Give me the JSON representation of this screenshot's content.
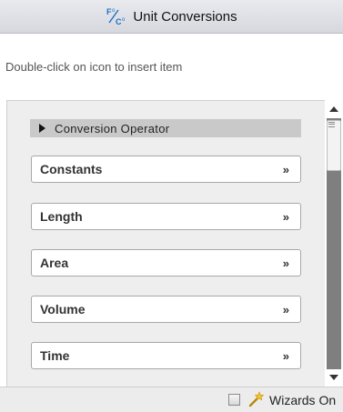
{
  "window": {
    "title": "Unit Conversions",
    "title_icon": "unit-conversions-icon"
  },
  "hint": "Double-click on icon to insert item",
  "conversion_operator": {
    "label": "Conversion Operator",
    "icon": "triangle-right-icon"
  },
  "categories": [
    {
      "label": "Constants",
      "icon": "double-chevron-down-icon"
    },
    {
      "label": "Length",
      "icon": "double-chevron-down-icon"
    },
    {
      "label": "Area",
      "icon": "double-chevron-down-icon"
    },
    {
      "label": "Volume",
      "icon": "double-chevron-down-icon"
    },
    {
      "label": "Time",
      "icon": "double-chevron-down-icon"
    }
  ],
  "footer": {
    "wizards_label": "Wizards On",
    "wizards_checked": false,
    "wizards_icon": "wand-icon"
  },
  "colors": {
    "titlebar_bg": "#dfe1e6",
    "panel_bg": "#eeeeee",
    "header_bg": "#c9c9c9",
    "scroll_track": "#7f7f7f"
  }
}
